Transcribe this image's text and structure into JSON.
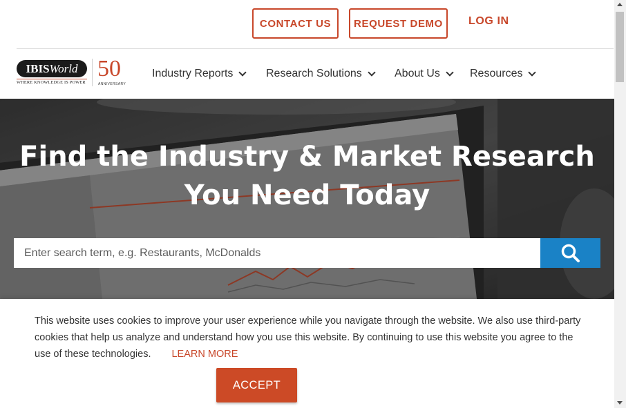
{
  "topbar": {
    "contact_label": "CONTACT US",
    "demo_label": "REQUEST DEMO",
    "login_label": "LOG IN"
  },
  "logo": {
    "brand_bold": "IBIS",
    "brand_italic": "World",
    "tagline": "WHERE KNOWLEDGE IS POWER",
    "anniversary_number": "50",
    "anniversary_label": "ANNIVERSARY"
  },
  "nav": {
    "items": [
      {
        "label": "Industry Reports"
      },
      {
        "label": "Research Solutions"
      },
      {
        "label": "About Us"
      },
      {
        "label": "Resources"
      }
    ]
  },
  "hero": {
    "title": "Find the Industry & Market Research You Need Today",
    "search_placeholder": "Enter search term, e.g. Restaurants, McDonalds",
    "search_icon": "search-icon"
  },
  "cookie": {
    "text": "This website uses cookies to improve your user experience while you navigate through the website. We also use third-party cookies that help us analyze and understand how you use this website. By continuing to use this website you agree to the use of these technologies.",
    "learn_more": "LEARN MORE",
    "accept_label": "ACCEPT"
  },
  "colors": {
    "brand_orange": "#c8472a",
    "search_blue": "#1a82c6",
    "accept_orange": "#cc4a26"
  }
}
